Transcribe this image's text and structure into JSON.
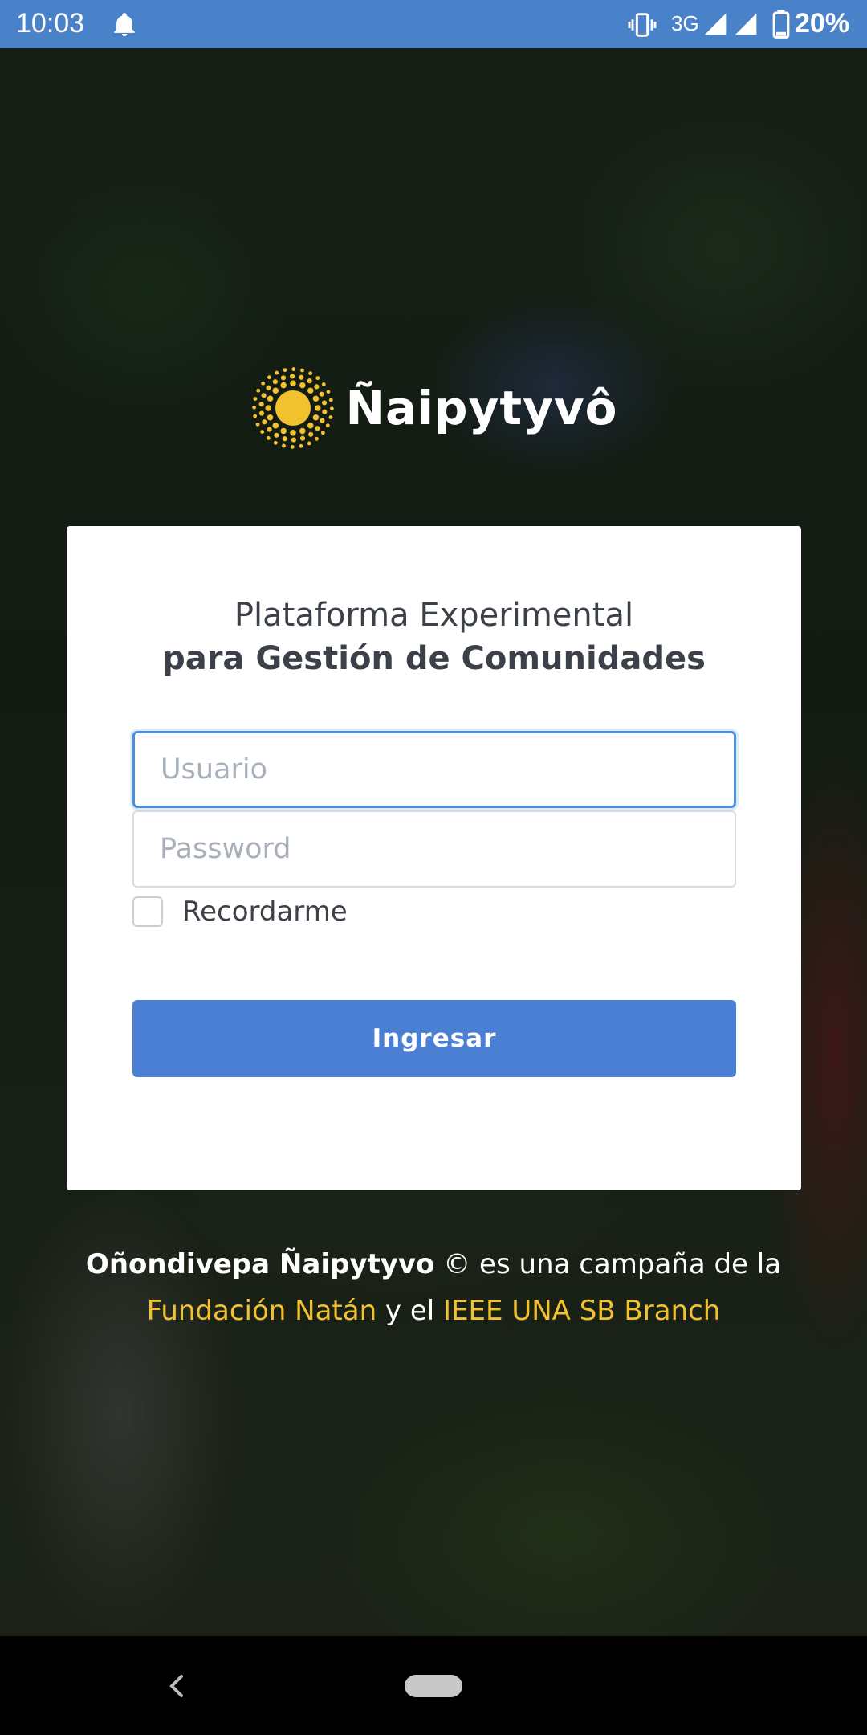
{
  "status_bar": {
    "time": "10:03",
    "network": "3G",
    "battery": "20%",
    "icons": [
      "bell-icon",
      "vibrate-icon",
      "signal-icon",
      "signal-icon",
      "battery-icon"
    ],
    "background_color": "#4a82c9"
  },
  "logo": {
    "text": "Ñaipytyvô",
    "icon": "sun-icon",
    "icon_color": "#f2c12e"
  },
  "login_card": {
    "title_line1": "Plataforma Experimental",
    "title_line2": "para Gestión de Comunidades",
    "username": {
      "value": "",
      "placeholder": "Usuario"
    },
    "password": {
      "value": "",
      "placeholder": "Password"
    },
    "remember_label": "Recordarme",
    "remember_checked": false,
    "submit_label": "Ingresar",
    "accent_color": "#4a7fd4"
  },
  "footer": {
    "brand": "Oñondivepa Ñaipytyvo",
    "text1": " © es una campaña de la",
    "link1": "Fundación Natán",
    "text2": " y el ",
    "link2": "IEEE UNA SB Branch",
    "link_color": "#f2c12e"
  },
  "nav_bar": {
    "icons": [
      "back-icon",
      "home-pill-icon"
    ]
  }
}
